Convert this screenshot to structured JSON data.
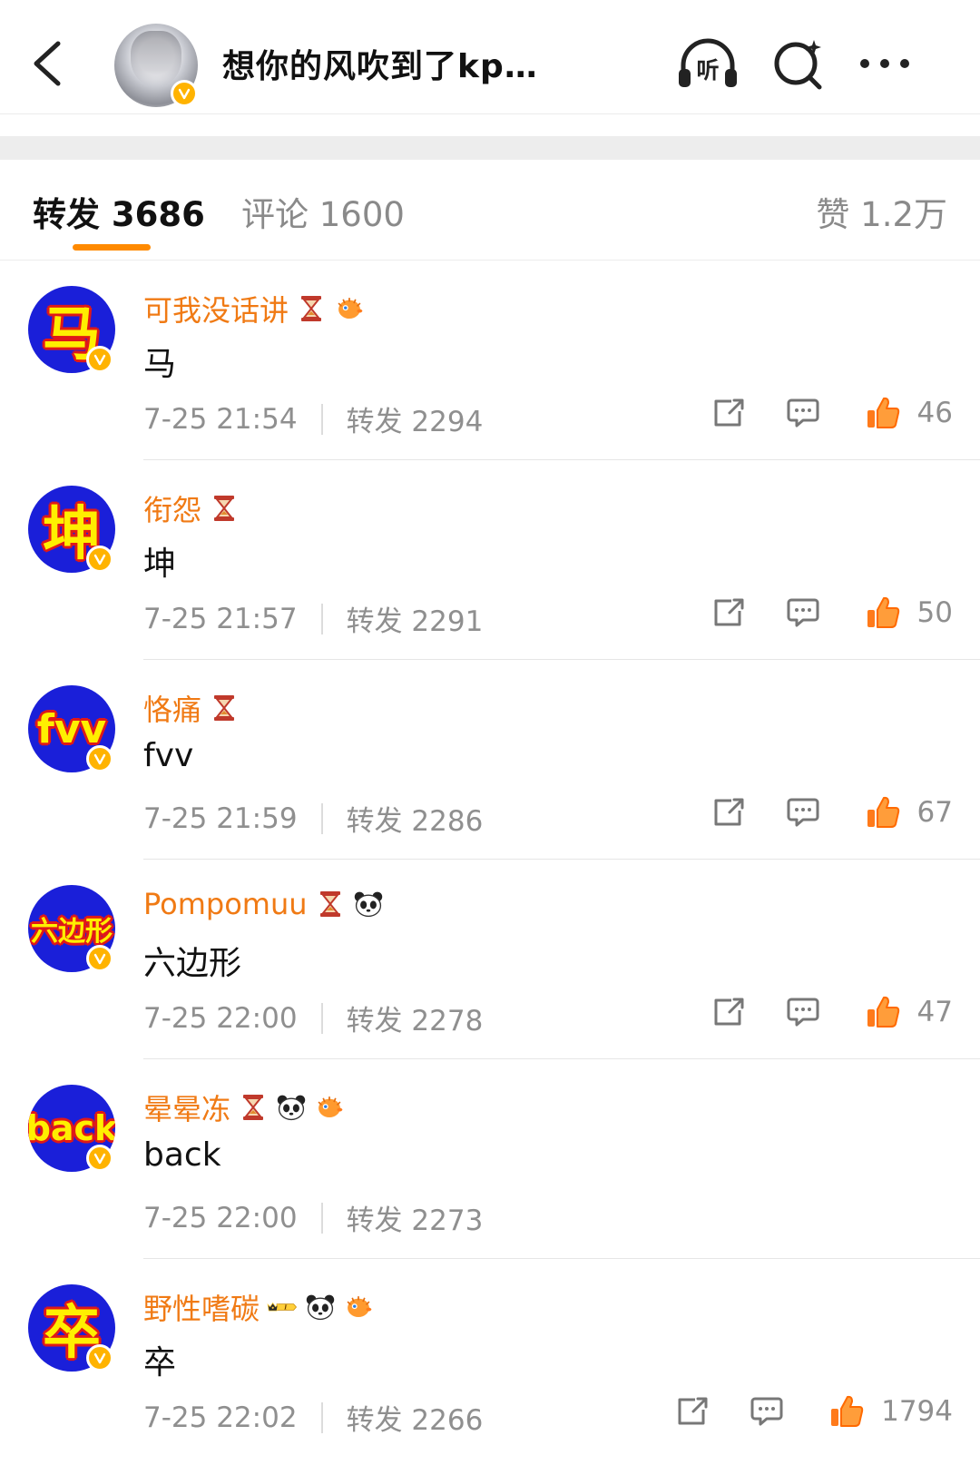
{
  "header": {
    "author_name": "想你的风吹到了kp…",
    "icons": [
      "back-icon",
      "listen-headphones-icon",
      "search-icon",
      "more-icon"
    ],
    "listen_label": "听"
  },
  "tabs": {
    "repost": "转发 3686",
    "comment": "评论 1600",
    "like": "赞 1.2万"
  },
  "colors": {
    "accent": "#ff8a00",
    "username": "#f07a14",
    "avatar_bg": "#1a1fd9",
    "like": "#ff7a1a"
  },
  "reposts": [
    {
      "avatar_text": "马",
      "username": "可我没话讲",
      "badges": [
        "hourglass-badge",
        "pufferfish-badge"
      ],
      "content": "马",
      "time": "7-25 21:54",
      "repost_count": "转发 2294",
      "likes": "46",
      "show_actions": true
    },
    {
      "avatar_text": "坤",
      "username": "衔怨",
      "badges": [
        "hourglass-badge"
      ],
      "content": "坤",
      "time": "7-25 21:57",
      "repost_count": "转发 2291",
      "likes": "50",
      "show_actions": true
    },
    {
      "avatar_text": "fvv",
      "username": "恪痛",
      "badges": [
        "hourglass-badge"
      ],
      "content": "fvv",
      "time": "7-25 21:59",
      "repost_count": "转发 2286",
      "likes": "67",
      "show_actions": true
    },
    {
      "avatar_text": "六边形",
      "username": "Pompomuu",
      "badges": [
        "hourglass-badge",
        "panda-badge"
      ],
      "content": "六边形",
      "time": "7-25 22:00",
      "repost_count": "转发 2278",
      "likes": "47",
      "show_actions": true
    },
    {
      "avatar_text": "back",
      "username": "晕晕冻",
      "badges": [
        "hourglass-badge",
        "panda-badge",
        "pufferfish-badge"
      ],
      "content": "back",
      "time": "7-25 22:00",
      "repost_count": "转发 2273",
      "likes": "",
      "show_actions": false
    },
    {
      "avatar_text": "卒",
      "username": "野性嗜碳",
      "badges": [
        "crown-level-badge",
        "panda-badge",
        "pufferfish-badge"
      ],
      "content": "卒",
      "time": "7-25 22:02",
      "repost_count": "转发 2266",
      "likes": "1794",
      "show_actions": true
    }
  ]
}
